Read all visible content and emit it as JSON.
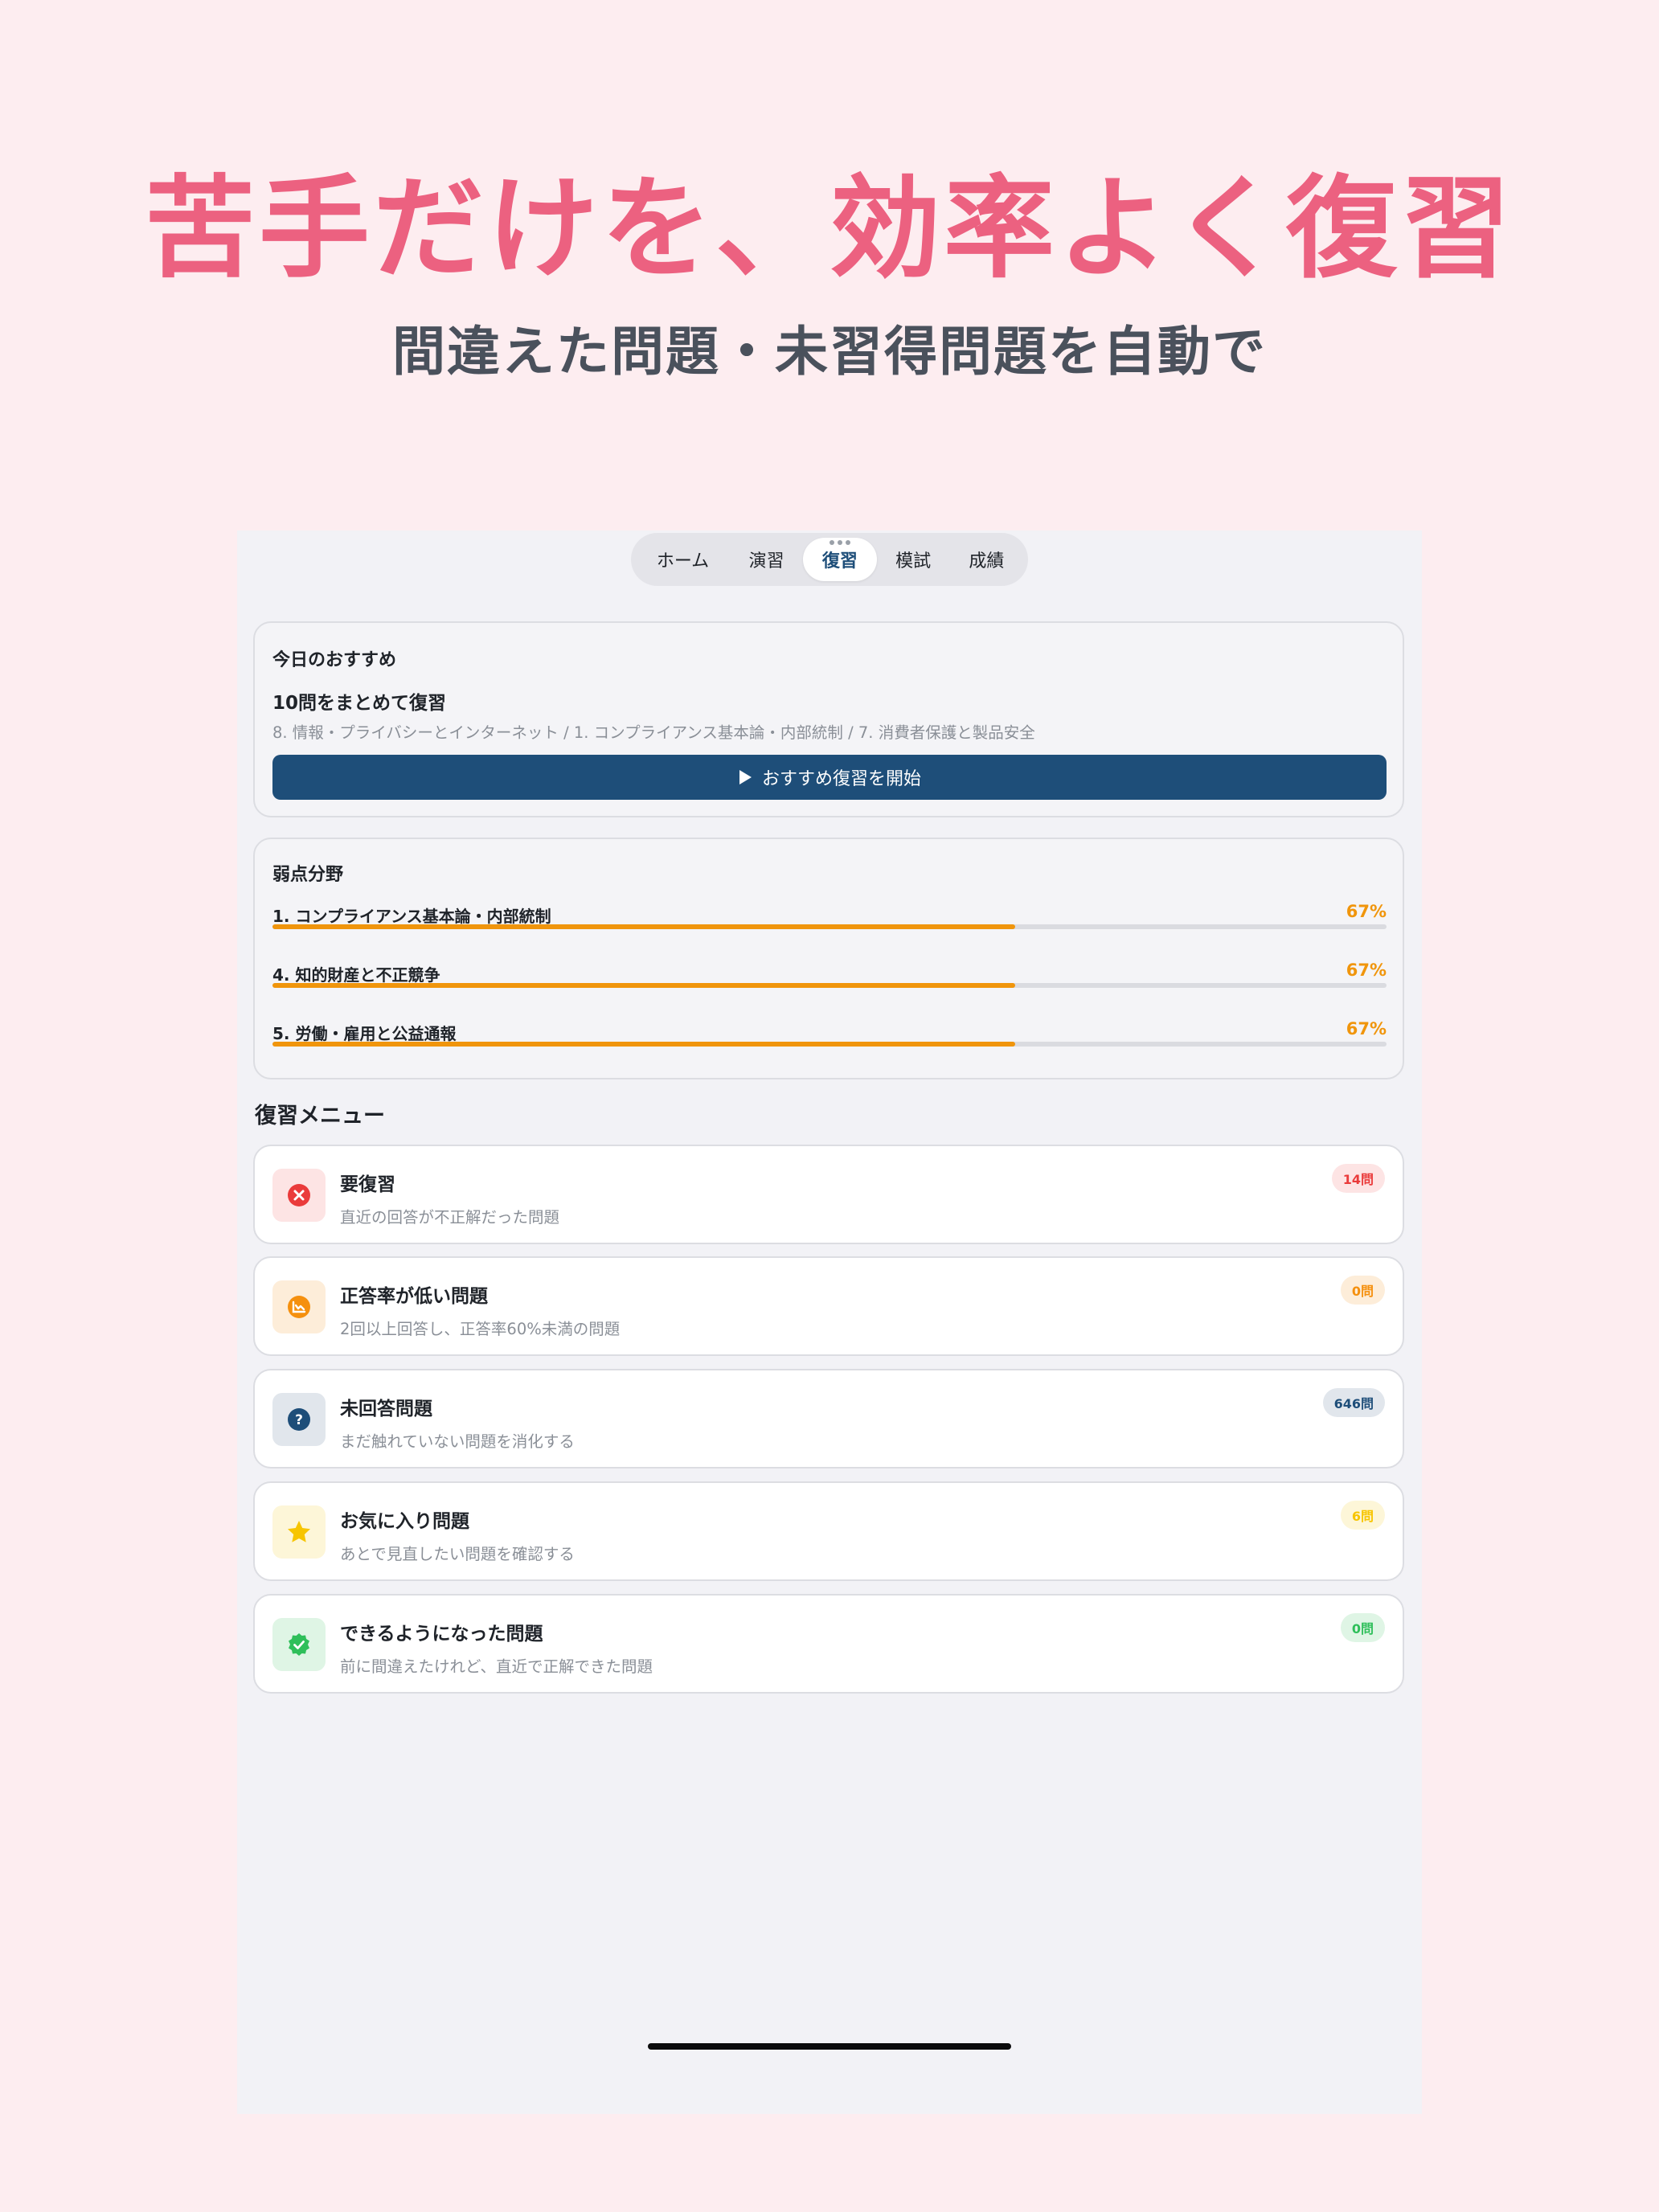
{
  "promo": {
    "headline": "苦手だけを、効率よく復習",
    "subline": "間違えた問題・未習得問題を自動で"
  },
  "tabs": [
    "ホーム",
    "演習",
    "復習",
    "模試",
    "成績"
  ],
  "active_tab": "復習",
  "recommend": {
    "title": "今日のおすすめ",
    "subtitle": "10問をまとめて復習",
    "categories": "8. 情報・プライバシーとインターネット / 1. コンプライアンス基本論・内部統制 / 7. 消費者保護と製品安全",
    "start_label": "おすすめ復習を開始",
    "start_icon": "play-icon"
  },
  "weak": {
    "title": "弱点分野",
    "items": [
      {
        "name": "1. コンプライアンス基本論・内部統制",
        "pct_label": "67%",
        "value": 0.6667
      },
      {
        "name": "4. 知的財産と不正競争",
        "pct_label": "67%",
        "value": 0.6667
      },
      {
        "name": "5. 労働・雇用と公益通報",
        "pct_label": "67%",
        "value": 0.6667
      }
    ]
  },
  "menu": {
    "title": "復習メニュー",
    "items": [
      {
        "title": "要復習",
        "desc": "直近の回答が不正解だった問題",
        "badge": "14問",
        "icon": "x-circle-icon",
        "color": "#ea3b3b",
        "bg": "#fde4e4",
        "badge_bg": "#fde4e4"
      },
      {
        "title": "正答率が低い問題",
        "desc": "2回以上回答し、正答率60%未満の問題",
        "badge": "0問",
        "icon": "chart-down-icon",
        "color": "#f5900e",
        "bg": "#fdedd9",
        "badge_bg": "#fdedd9"
      },
      {
        "title": "未回答問題",
        "desc": "まだ触れていない問題を消化する",
        "badge": "646問",
        "icon": "question-circle-icon",
        "color": "#1e4e79",
        "bg": "#e1e6ec",
        "badge_bg": "#e1e6ec"
      },
      {
        "title": "お気に入り問題",
        "desc": "あとで見直したい問題を確認する",
        "badge": "6問",
        "icon": "star-icon",
        "color": "#f7c500",
        "bg": "#fdf6d8",
        "badge_bg": "#fdf6d8"
      },
      {
        "title": "できるようになった問題",
        "desc": "前に間違えたけれど、直近で正解できた問題",
        "badge": "0問",
        "icon": "check-badge-icon",
        "color": "#2fbf5a",
        "bg": "#dff5e5",
        "badge_bg": "#dff5e5"
      }
    ]
  }
}
